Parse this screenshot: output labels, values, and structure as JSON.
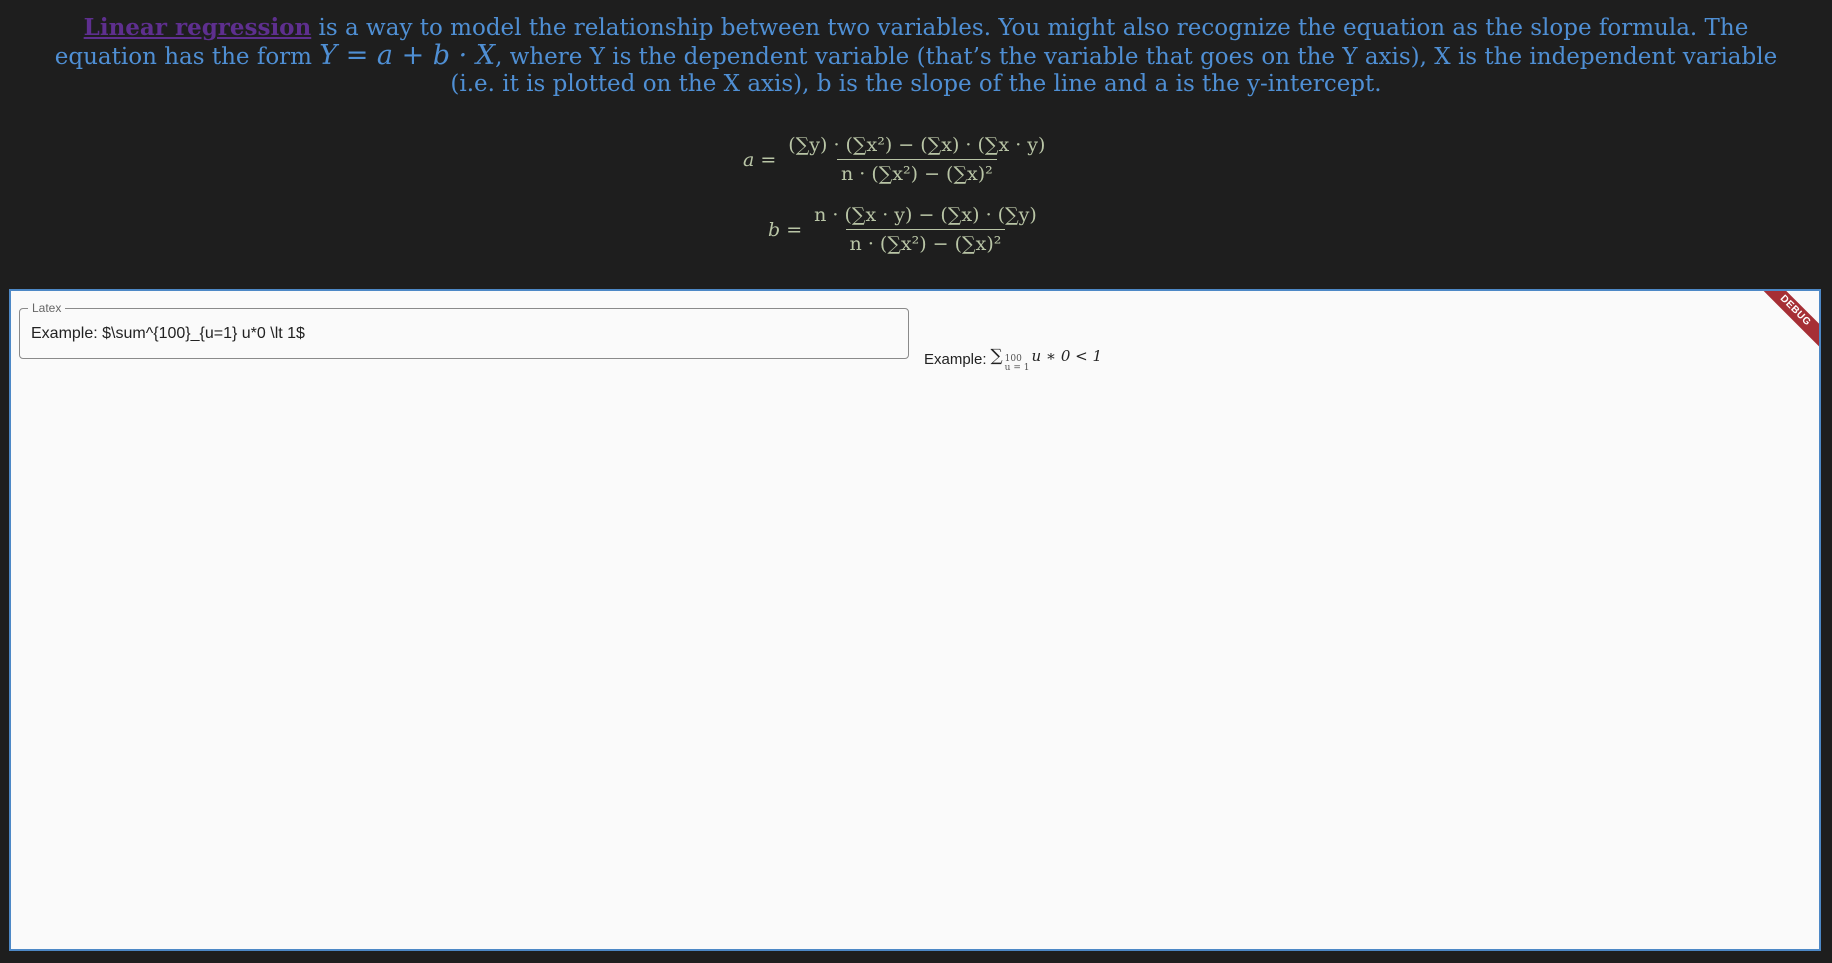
{
  "intro": {
    "link": "Linear regression",
    "text1": " is a way to model the relationship between two variables. You might also recognize the equation as the slope formula. The equation has the form ",
    "math_Y": "Y",
    "math_eq": " = a + b · X",
    "text2": ", where Y is the dependent variable (that’s the variable that goes on the Y axis), X is the independent variable (i.e. it is plotted on the X axis), b is the slope of the line and a is the y-intercept."
  },
  "formulas": {
    "a": {
      "lhs": "a =",
      "num": "(∑y) · (∑x²) − (∑x) · (∑x · y)",
      "den": "n · (∑x²) − (∑x)²"
    },
    "b": {
      "lhs": "b =",
      "num": "n · (∑x · y) − (∑x) · (∑y)",
      "den": "n · (∑x²) − (∑x)²"
    }
  },
  "latex_field": {
    "label": "Latex",
    "value": "Example: $\\sum^{100}_{u=1} u*0 \\lt 1$"
  },
  "preview": {
    "prefix": "Example:",
    "sigma": "∑",
    "upper": "100",
    "lower": "u = 1",
    "body": "u ∗ 0 < 1"
  },
  "debug_banner": "DEBUG",
  "colors": {
    "background": "#1e1e1e",
    "intro_text": "#4f8fd4",
    "link": "#5e2f8f",
    "formula": "#b9c5a6",
    "panel": "#fafafa",
    "panel_border": "#4d88c6",
    "debug_banner": "#a62f35"
  }
}
